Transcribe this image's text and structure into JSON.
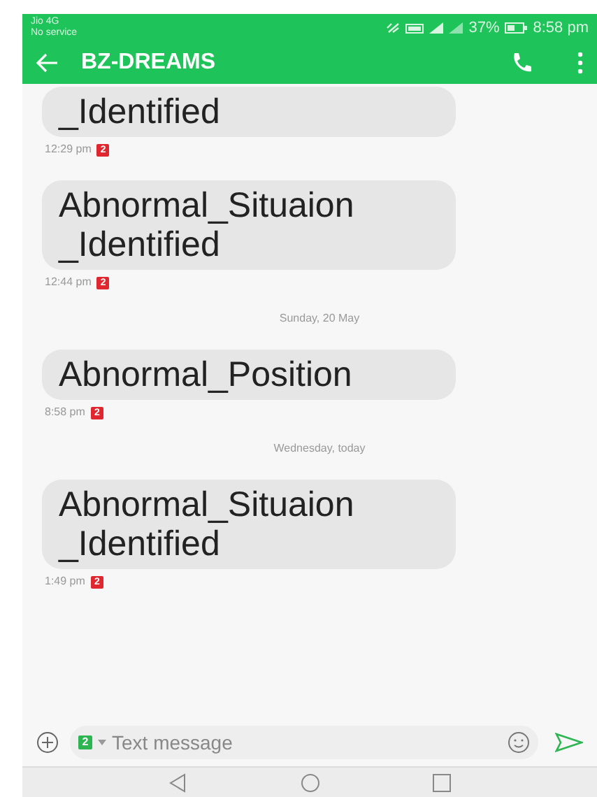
{
  "status_bar": {
    "carrier": "Jio 4G",
    "service": "No service",
    "battery": "37%",
    "time": "8:58 pm"
  },
  "toolbar": {
    "title": "BZ-DREAMS"
  },
  "thread": [
    {
      "kind": "message",
      "text": "_Identified",
      "time": "12:29 pm",
      "sim": "2"
    },
    {
      "kind": "message",
      "text": "Abnormal_Situaion _Identified",
      "time": "12:44 pm",
      "sim": "2"
    },
    {
      "kind": "date",
      "text": "Sunday, 20 May"
    },
    {
      "kind": "message",
      "text": "Abnormal_Position",
      "time": "8:58 pm",
      "sim": "2"
    },
    {
      "kind": "date",
      "text": "Wednesday, today"
    },
    {
      "kind": "message",
      "text": "Abnormal_Situaion _Identified",
      "time": "1:49 pm",
      "sim": "2"
    }
  ],
  "composer": {
    "sim": "2",
    "placeholder": "Text message"
  }
}
